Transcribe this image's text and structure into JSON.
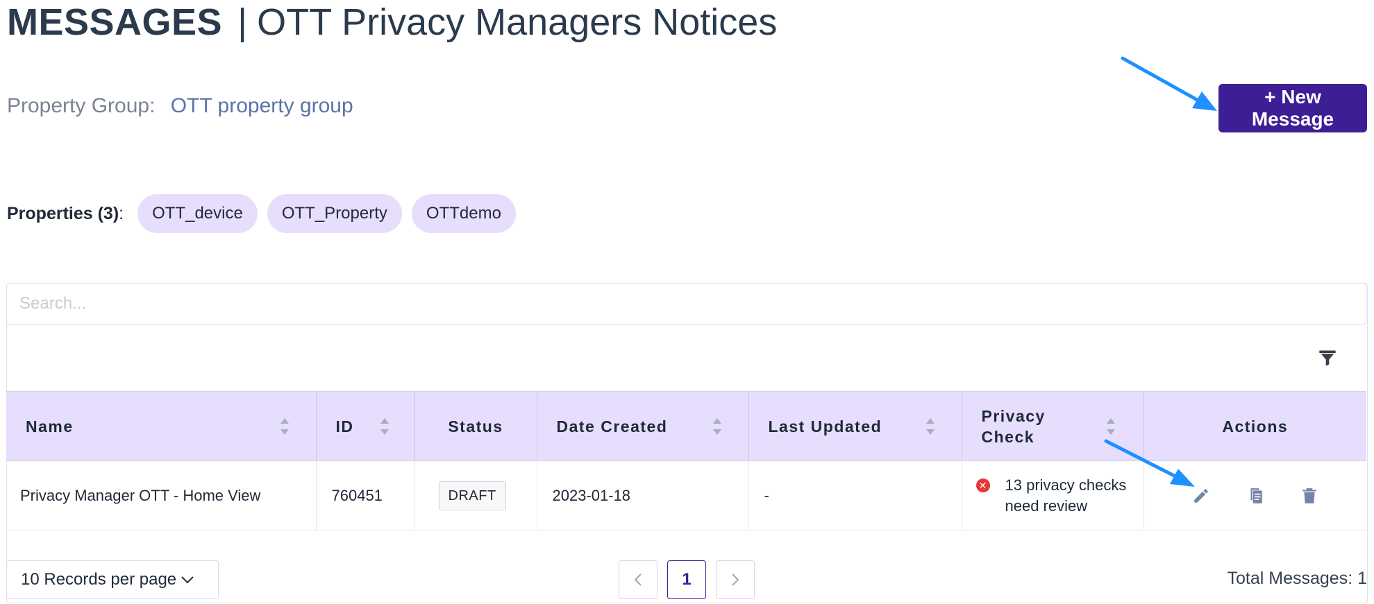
{
  "header": {
    "title_bold": "MESSAGES",
    "separator": "|",
    "title_rest": "OTT Privacy Managers Notices"
  },
  "property_group": {
    "label": "Property Group:",
    "value": "OTT property group"
  },
  "new_message_button": "+ New Message",
  "properties": {
    "label": "Properties (3)",
    "colon": ":",
    "items": [
      "OTT_device",
      "OTT_Property",
      "OTTdemo"
    ]
  },
  "search": {
    "placeholder": "Search..."
  },
  "table": {
    "columns": [
      "Name",
      "ID",
      "Status",
      "Date Created",
      "Last Updated",
      "Privacy Check",
      "Actions"
    ],
    "rows": [
      {
        "name": "Privacy Manager OTT - Home View",
        "id": "760451",
        "status": "DRAFT",
        "date_created": "2023-01-18",
        "last_updated": "-",
        "privacy_check": "13 privacy checks need review"
      }
    ]
  },
  "pagination": {
    "records_per_page": "10 Records per page",
    "current_page": "1",
    "total": "Total Messages: 1"
  },
  "icons": {
    "filter": "filter-icon",
    "edit": "pencil-icon",
    "copy": "copy-icon",
    "delete": "trash-icon",
    "error": "error-icon",
    "chevron": "chevron-down-icon"
  },
  "colors": {
    "primary": "#3e1e95",
    "header_bg": "#e6defc",
    "chip_bg": "#e6defc",
    "error": "#e53935",
    "link": "#5a74a8",
    "annotation_arrow": "#1e90ff"
  }
}
